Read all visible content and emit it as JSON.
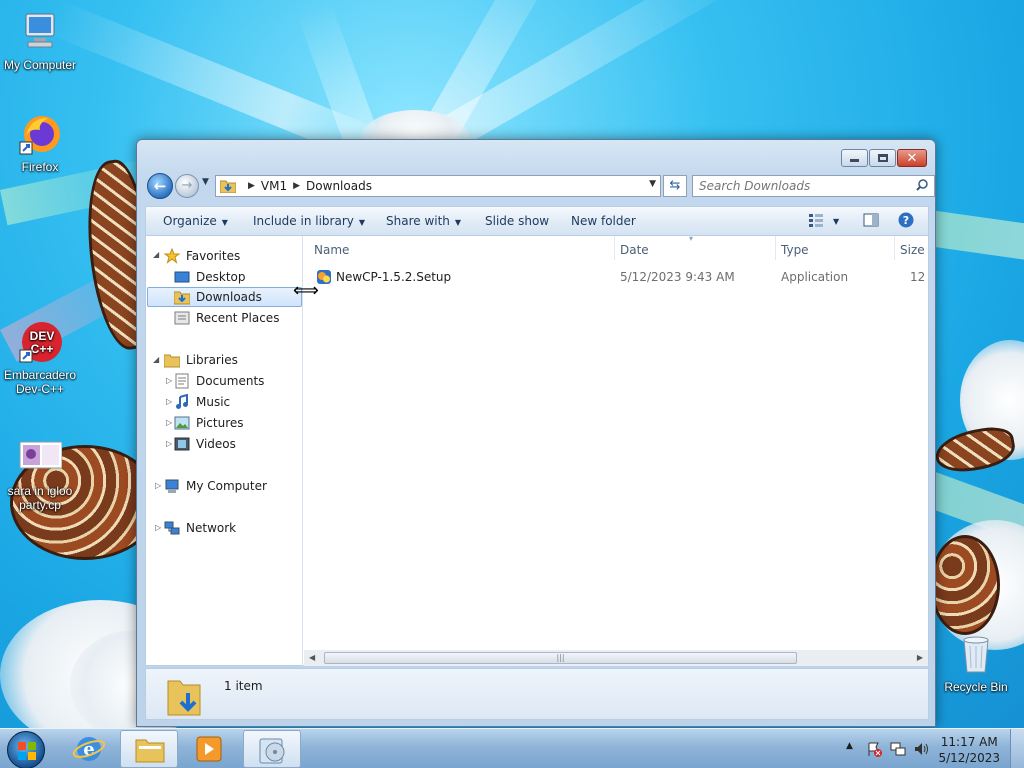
{
  "desktop": {
    "icons": [
      {
        "label": "My Computer"
      },
      {
        "label": "Firefox"
      },
      {
        "label": "Embarcadero Dev-C++"
      },
      {
        "label": "sara in igloo party.cp"
      },
      {
        "label": "Recycle Bin"
      }
    ],
    "devcpp_badge": "DEV\nC++"
  },
  "window": {
    "address": {
      "crumbs": [
        "VM1",
        "Downloads"
      ],
      "search_placeholder": "Search Downloads"
    },
    "command_bar": {
      "organize": "Organize",
      "include_in_library": "Include in library",
      "share_with": "Share with",
      "slide_show": "Slide show",
      "new_folder": "New folder"
    },
    "nav_pane": {
      "favorites": "Favorites",
      "desktop": "Desktop",
      "downloads": "Downloads",
      "recent_places": "Recent Places",
      "libraries": "Libraries",
      "documents": "Documents",
      "music": "Music",
      "pictures": "Pictures",
      "videos": "Videos",
      "my_computer": "My Computer",
      "network": "Network"
    },
    "columns": {
      "name": "Name",
      "date": "Date",
      "type": "Type",
      "size": "Size"
    },
    "files": [
      {
        "name": "NewCP-1.5.2.Setup",
        "date": "5/12/2023 9:43 AM",
        "type": "Application",
        "size": "12"
      }
    ],
    "details": {
      "count": "1 item"
    }
  },
  "taskbar": {
    "time": "11:17 AM",
    "date": "5/12/2023"
  },
  "colors": {
    "accent": "#2d74c4",
    "selection": "#cfe4fb",
    "close": "#c9422a"
  }
}
